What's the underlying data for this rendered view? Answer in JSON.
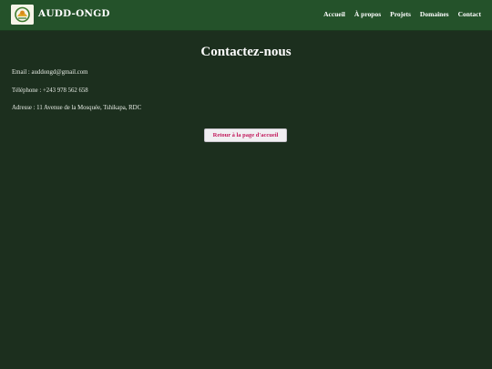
{
  "header": {
    "brand": "AUDD-ONGD",
    "logo_icon": "organization-logo",
    "nav": [
      "Accueil",
      "À propos",
      "Projets",
      "Domaines",
      "Contact"
    ]
  },
  "main": {
    "title": "Contactez-nous",
    "email": "Email : auddongd@gmail.com",
    "phone": "Téléphone : +243 978 562 658",
    "address": "Adresse : 11 Avenue de la Mosquée, Tshikapa, RDC",
    "back_button": "Retour à la page d'accueil"
  },
  "colors": {
    "background": "#1c2f1e",
    "header": "#24522a",
    "button_text": "#c2185b"
  }
}
